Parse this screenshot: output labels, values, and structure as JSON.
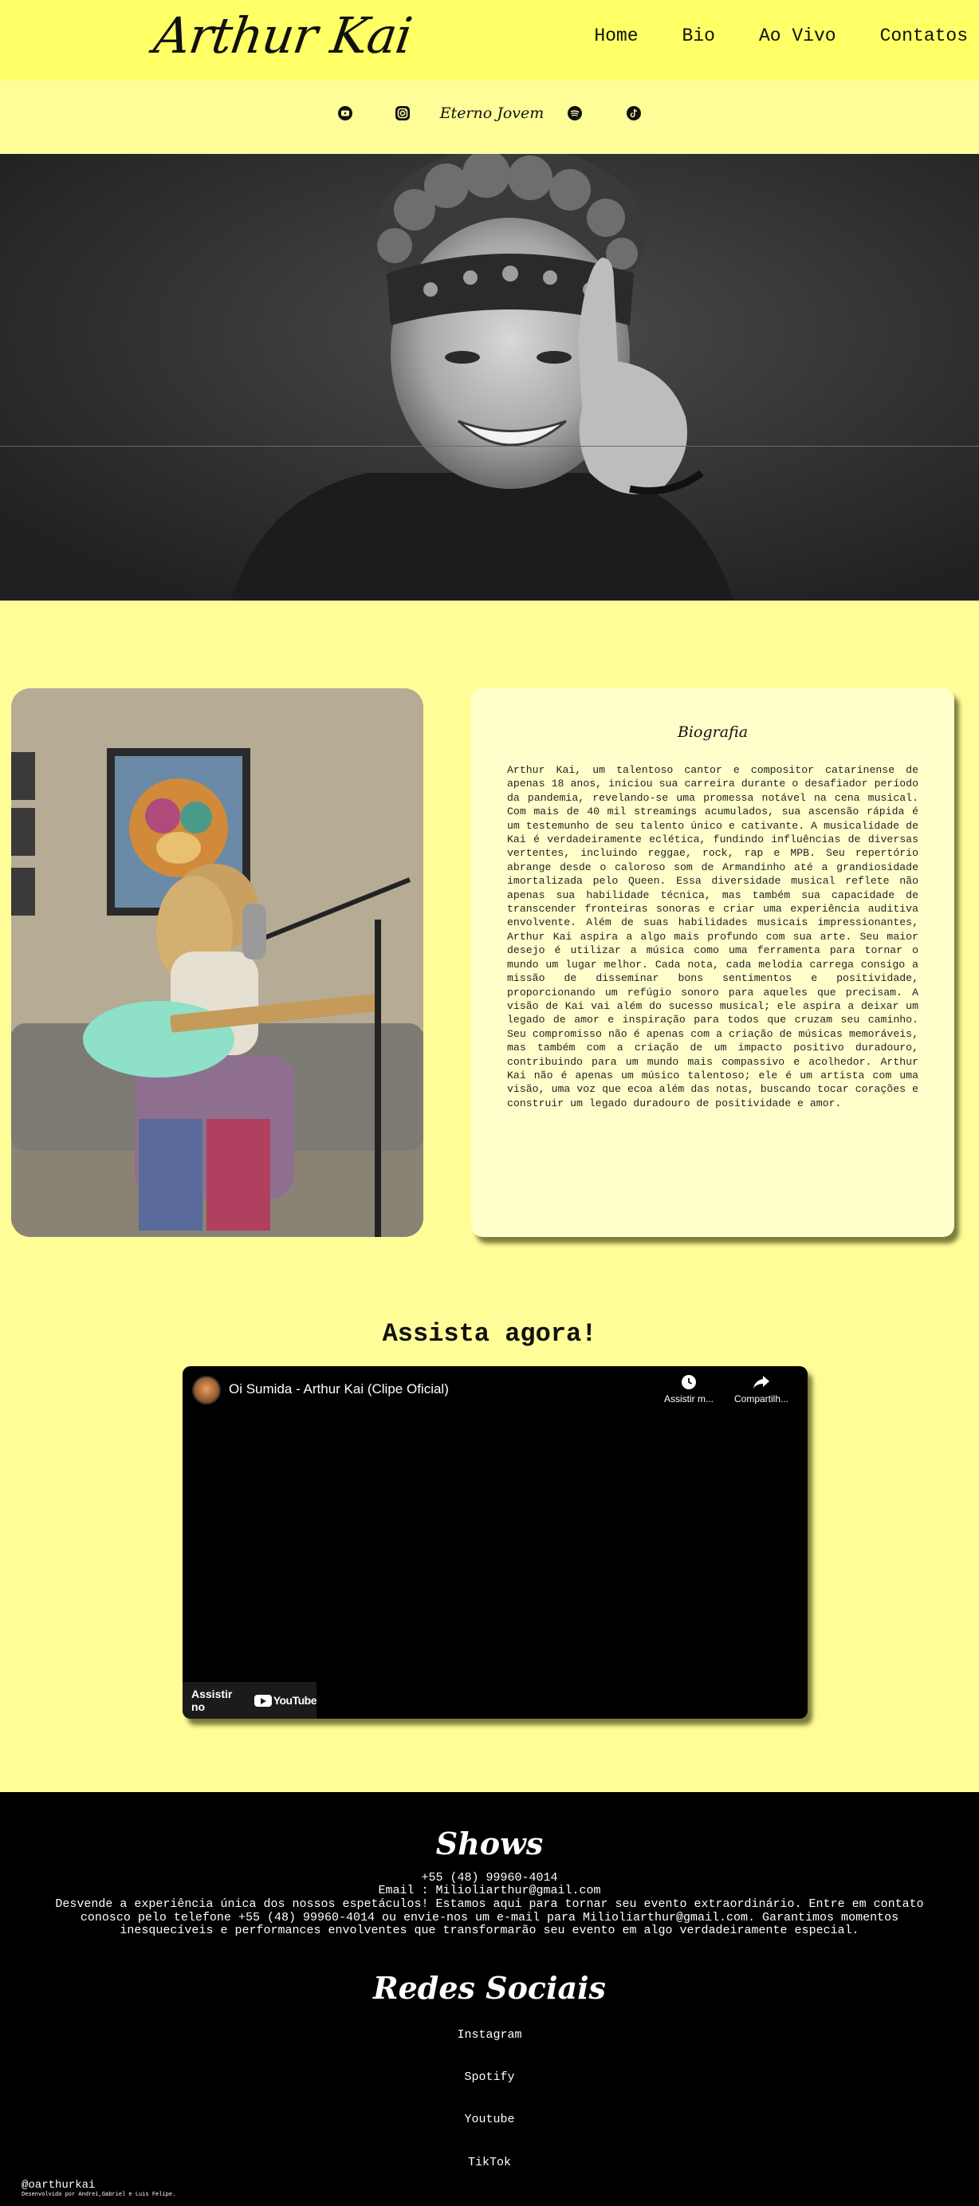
{
  "header": {
    "logo": "Arthur Kai",
    "nav": [
      "Home",
      "Bio",
      "Ao Vivo",
      "Contatos"
    ]
  },
  "subbar": {
    "icons": [
      "youtube-icon",
      "instagram-icon",
      "spotify-icon",
      "tiktok-icon"
    ],
    "album": "Eterno Jovem"
  },
  "bio": {
    "title": "Biografia",
    "text": "Arthur Kai, um talentoso cantor e compositor catarinense de apenas 18 anos, iniciou sua carreira durante o desafiador período da pandemia, revelando-se uma promessa notável na cena musical. Com mais de 40 mil streamings acumulados, sua ascensão rápida é um testemunho de seu talento único e cativante. A musicalidade de Kai é verdadeiramente eclética, fundindo influências de diversas vertentes, incluindo reggae, rock, rap e MPB. Seu repertório abrange desde o caloroso som de Armandinho até a grandiosidade imortalizada pelo Queen. Essa diversidade musical reflete não apenas sua habilidade técnica, mas também sua capacidade de transcender fronteiras sonoras e criar uma experiência auditiva envolvente. Além de suas habilidades musicais impressionantes, Arthur Kai aspira a algo mais profundo com sua arte. Seu maior desejo é utilizar a música como uma ferramenta para tornar o mundo um lugar melhor. Cada nota, cada melodia carrega consigo a missão de disseminar bons sentimentos e positividade, proporcionando um refúgio sonoro para aqueles que precisam. A visão de Kai vai além do sucesso musical; ele aspira a deixar um legado de amor e inspiração para todos que cruzam seu caminho. Seu compromisso não é apenas com a criação de músicas memoráveis, mas também com a criação de um impacto positivo duradouro, contribuindo para um mundo mais compassivo e acolhedor. Arthur Kai não é apenas um músico talentoso; ele é um artista com uma visão, uma voz que ecoa além das notas, buscando tocar corações e construir um legado duradouro de positividade e amor."
  },
  "video": {
    "section_title": "Assista agora!",
    "title": "Oi Sumida - Arthur Kai (Clipe Oficial)",
    "watch_later": "Assistir m...",
    "share": "Compartilh...",
    "watch_on": "Assistir no",
    "yt_wordmark": "YouTube"
  },
  "footer": {
    "shows_title": "Shows",
    "phone": "+55 (48) 99960-4014",
    "email": "Email : Milioliarthur@gmail.com",
    "description": "Desvende a experiência única dos nossos espetáculos! Estamos aqui para tornar seu evento extraordinário. Entre em contato conosco pelo telefone +55 (48) 99960-4014 ou envie-nos um e-mail para Milioliarthur@gmail.com. Garantimos momentos inesquecíveis e performances envolventes que transformarão seu evento em algo verdadeiramente especial.",
    "social_title": "Redes Sociais",
    "links": [
      "Instagram",
      "Spotify",
      "Youtube",
      "TikTok"
    ],
    "handle": "@oarthurkai",
    "credit": "Desenvolvido por Andrei,Gabriel e Luis Felipe."
  }
}
